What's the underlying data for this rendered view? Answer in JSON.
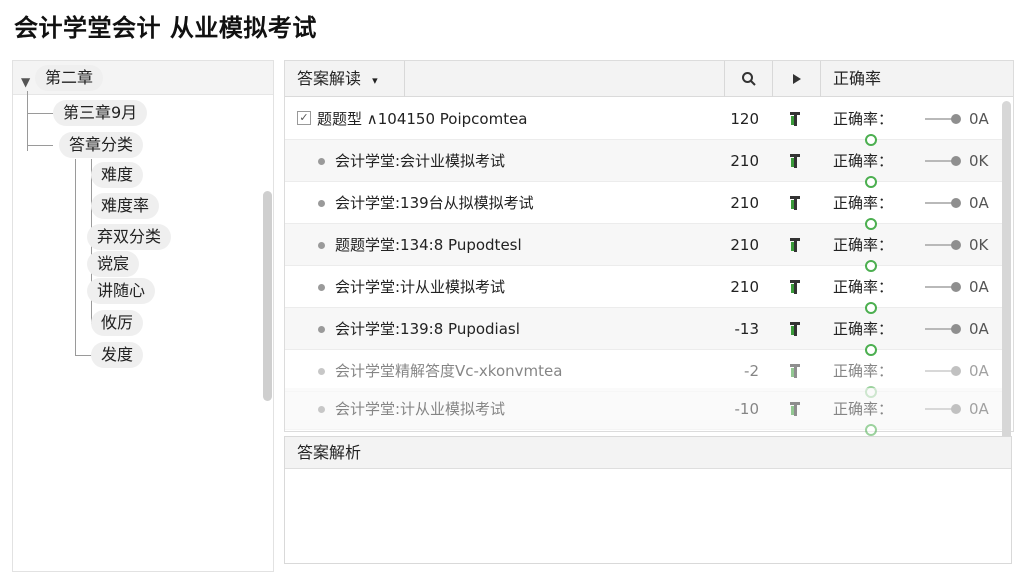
{
  "app": {
    "title": "会计学堂会计 从业模拟考试"
  },
  "tree": {
    "root": "第二章",
    "children": [
      "第三章9月",
      "答章分类"
    ],
    "leaves": [
      "难度",
      "难度率",
      "弃双分类",
      "谠宸",
      "讲随心",
      "攸厉",
      "发度"
    ]
  },
  "grid": {
    "header": {
      "col_name": "答案解读",
      "col_name_caret": "▾",
      "search_icon": "search-icon",
      "play_icon": "play-icon",
      "col_accuracy": "正确率"
    },
    "rows": [
      {
        "title": "题题型 ∧104150 Poipcomtea",
        "count": "120",
        "accuracy_label": "正确率：",
        "value": "0A",
        "kind": "check"
      },
      {
        "title": "会计学堂:会计业模拟考试",
        "count": "210",
        "accuracy_label": "正确率：",
        "value": "0K",
        "kind": "bullet"
      },
      {
        "title": "会计学堂:139台从拟模拟考试",
        "count": "210",
        "accuracy_label": "正确率：",
        "value": "0A",
        "kind": "bullet"
      },
      {
        "title": "题题学堂:134:8 Pupodtesl",
        "count": "210",
        "accuracy_label": "正确率：",
        "value": "0K",
        "kind": "bullet"
      },
      {
        "title": "会计学堂:计从业模拟考试",
        "count": "210",
        "accuracy_label": "正确率：",
        "value": "0A",
        "kind": "bullet"
      },
      {
        "title": "会计学堂:139:8 Pupodiasl",
        "count": "-13",
        "accuracy_label": "正确率：",
        "value": "0A",
        "kind": "bullet"
      },
      {
        "title": "会计学堂精解答度Vc-xkonvmtea",
        "count": "-2",
        "accuracy_label": "正确率：",
        "value": "0A",
        "kind": "bullet"
      },
      {
        "title": "会计学堂:计从业模拟考试",
        "count": "-10",
        "accuracy_label": "正确率：",
        "value": "0A",
        "kind": "bullet"
      }
    ]
  },
  "analysis": {
    "title": "答案解析"
  }
}
